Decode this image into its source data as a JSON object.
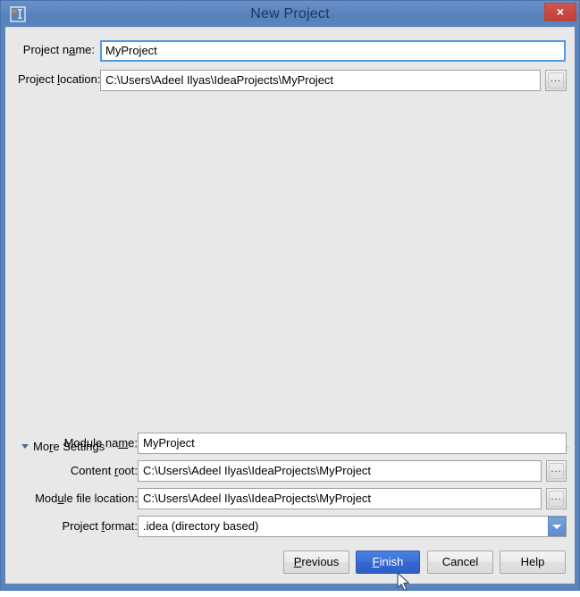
{
  "window": {
    "title": "New Project",
    "icon": "intellij-idea-icon",
    "close_label": "×",
    "accent_blue": "#5b84be",
    "dialog_bg": "#e8e8e8",
    "primary_button_blue": "#3366cf",
    "close_button_red": "#c94a42"
  },
  "top_form": {
    "fields": [
      {
        "label_before": "Project n",
        "label_mnemonic": "a",
        "label_after": "me:",
        "value": "MyProject",
        "has_browse": false,
        "focused": true
      },
      {
        "label_before": "Project ",
        "label_mnemonic": "l",
        "label_after": "ocation:",
        "value": "C:\\Users\\Adeel Ilyas\\IdeaProjects\\MyProject",
        "has_browse": true,
        "focused": false
      }
    ],
    "browse_label": "..."
  },
  "more_settings": {
    "label_before": "Mo",
    "label_mnemonic": "r",
    "label_after": "e Settings",
    "expanded": true,
    "fields": [
      {
        "label_before": "Module na",
        "label_mnemonic": "m",
        "label_after": "e:",
        "value": "MyProject",
        "type": "text",
        "has_browse": false
      },
      {
        "label_before": "Content ",
        "label_mnemonic": "r",
        "label_after": "oot:",
        "value": "C:\\Users\\Adeel Ilyas\\IdeaProjects\\MyProject",
        "type": "text",
        "has_browse": true
      },
      {
        "label_before": "Mod",
        "label_mnemonic": "u",
        "label_after": "le file location:",
        "value": "C:\\Users\\Adeel Ilyas\\IdeaProjects\\MyProject",
        "type": "text",
        "has_browse": true
      },
      {
        "label_before": "Project ",
        "label_mnemonic": "f",
        "label_after": "ormat:",
        "value": ".idea (directory based)",
        "type": "combo",
        "has_browse": false
      }
    ],
    "browse_label": "..."
  },
  "buttons": [
    {
      "before": "",
      "mnemonic": "P",
      "after": "revious",
      "primary": false
    },
    {
      "before": "",
      "mnemonic": "F",
      "after": "inish",
      "primary": true
    },
    {
      "before": "Cancel",
      "mnemonic": "",
      "after": "",
      "primary": false
    },
    {
      "before": "Help",
      "mnemonic": "",
      "after": "",
      "primary": false
    }
  ]
}
